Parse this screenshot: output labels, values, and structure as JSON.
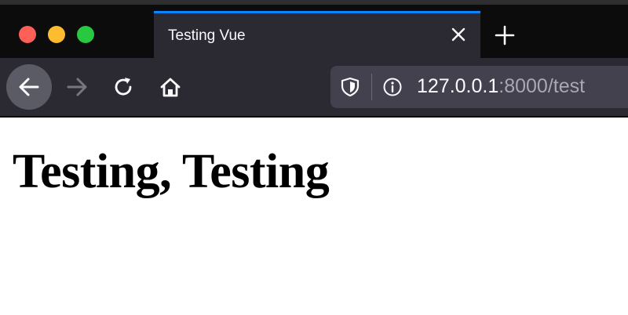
{
  "tab": {
    "title": "Testing Vue"
  },
  "address_bar": {
    "host": "127.0.0.1",
    "rest": ":8000/test"
  },
  "page": {
    "heading": "Testing, Testing"
  },
  "icons": {
    "close": "close-icon",
    "new_tab": "plus-icon",
    "back": "arrow-left-icon",
    "forward": "arrow-right-icon",
    "reload": "reload-icon",
    "home": "home-icon",
    "tracking": "shield-icon",
    "site_info": "info-icon"
  },
  "colors": {
    "tab_accent": "#0a84ff",
    "traffic_red": "#fe5f57",
    "traffic_yellow": "#febc2e",
    "traffic_green": "#28c840"
  }
}
